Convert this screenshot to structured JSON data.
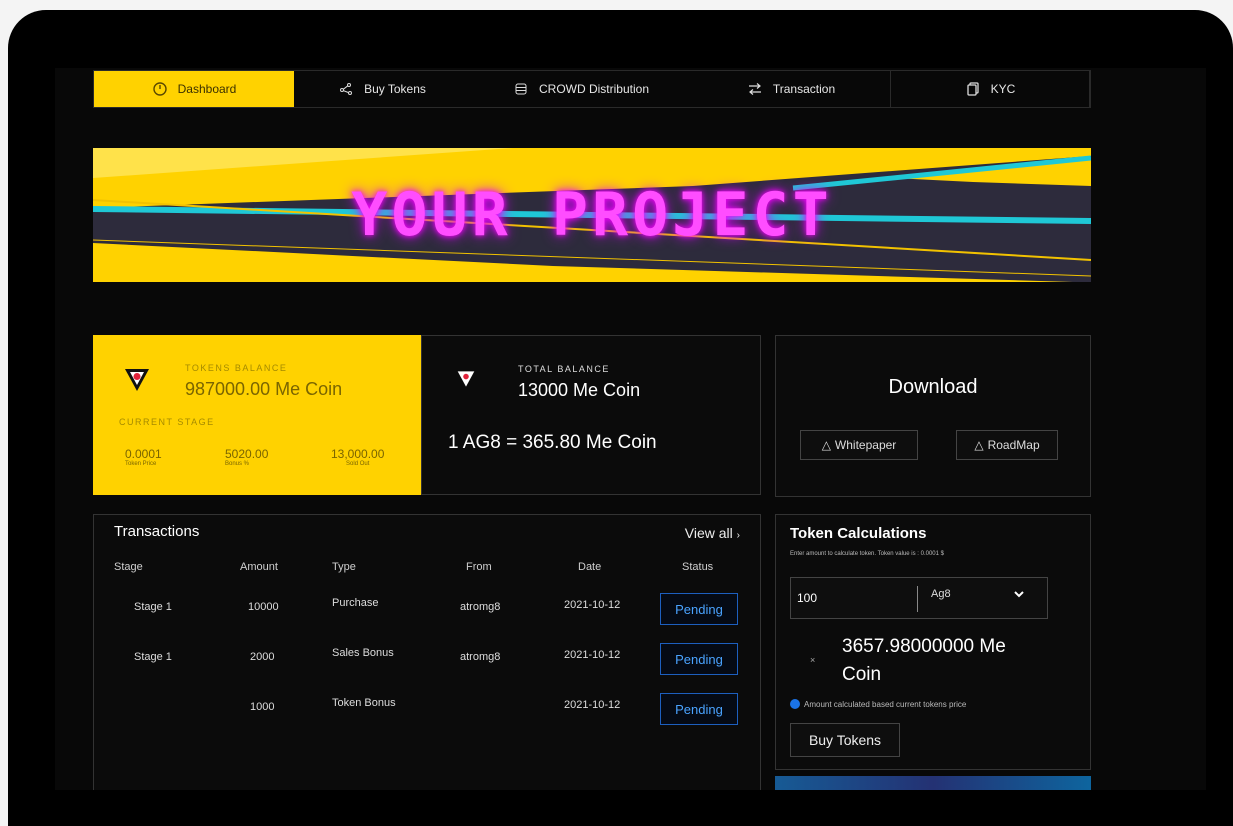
{
  "nav": {
    "items": [
      {
        "label": "Dashboard",
        "icon": "dashboard-icon",
        "active": true
      },
      {
        "label": "Buy Tokens",
        "icon": "network-icon",
        "active": false
      },
      {
        "label": "CROWD Distribution",
        "icon": "stack-icon",
        "active": false
      },
      {
        "label": "Transaction",
        "icon": "swap-arrows-icon",
        "active": false
      },
      {
        "label": "KYC",
        "icon": "documents-icon",
        "active": false
      }
    ]
  },
  "banner": {
    "title": "YOUR PROJECT"
  },
  "tokens_balance": {
    "label": "TOKENS BALANCE",
    "value": "987000.00 Me Coin",
    "stage_label": "CURRENT STAGE",
    "stats": [
      {
        "value": "0.0001",
        "caption": "Token Price"
      },
      {
        "value": "5020.00",
        "caption": "Bonus %"
      },
      {
        "value": "13,000.00",
        "caption": "Sold Out"
      }
    ]
  },
  "total_balance": {
    "label": "TOTAL BALANCE",
    "value": "13000 Me Coin",
    "rate": "1 AG8 = 365.80 Me Coin"
  },
  "download": {
    "title": "Download",
    "whitepaper": "Whitepaper",
    "roadmap": "RoadMap"
  },
  "transactions": {
    "title": "Transactions",
    "view_all": "View all",
    "columns": [
      "Stage",
      "Amount",
      "Type",
      "From",
      "Date",
      "Status"
    ],
    "rows": [
      {
        "stage": "Stage 1",
        "amount": "10000",
        "type": "Purchase",
        "from": "atromg8",
        "date": "2021-10-12",
        "status": "Pending"
      },
      {
        "stage": "Stage 1",
        "amount": "2000",
        "type": "Sales Bonus",
        "from": "atromg8",
        "date": "2021-10-12",
        "status": "Pending"
      },
      {
        "stage": "",
        "amount": "1000",
        "type": "Token Bonus",
        "from": "",
        "date": "2021-10-12",
        "status": "Pending"
      }
    ]
  },
  "calculator": {
    "title": "Token Calculations",
    "hint": "Enter amount to calculate token. Token value is : 0.0001 $",
    "input_value": "100",
    "currency": "Ag8",
    "multiplier": "×",
    "result_line1": "3657.98000000 Me",
    "result_line2": "Coin",
    "note": "Amount calculated based current tokens price",
    "buy_label": "Buy Tokens"
  },
  "colors": {
    "accent": "#ffd200",
    "pending": "#4aa3ff",
    "neon": "#ff4dff"
  }
}
